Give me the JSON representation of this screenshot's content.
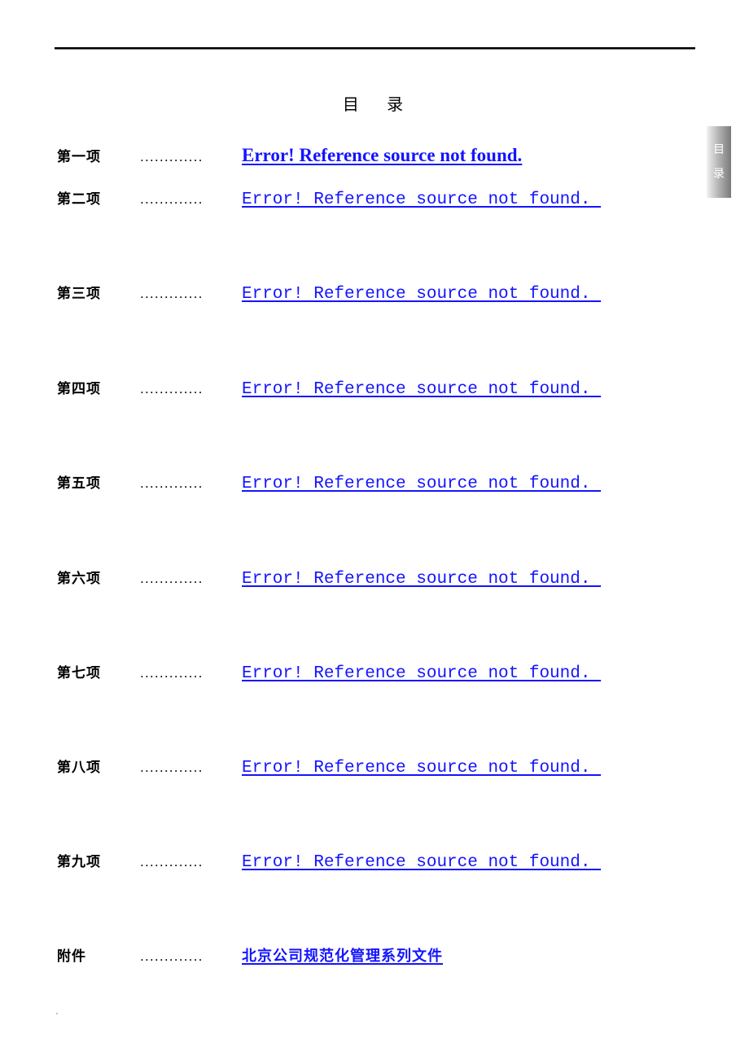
{
  "document": {
    "title": "目 录",
    "side_tab": [
      "目",
      "录"
    ],
    "toc": [
      {
        "label": "第一项",
        "dots": ".............",
        "link": "Error! Reference source not found.",
        "style": "bold"
      },
      {
        "label": "第二项",
        "dots": ".............",
        "link": "Error! Reference source not found. ",
        "style": "mono"
      },
      {
        "label": "第三项",
        "dots": ".............",
        "link": "Error! Reference source not found. ",
        "style": "mono"
      },
      {
        "label": "第四项",
        "dots": ".............",
        "link": "Error! Reference source not found. ",
        "style": "mono"
      },
      {
        "label": "第五项",
        "dots": ".............",
        "link": "Error! Reference source not found. ",
        "style": "mono"
      },
      {
        "label": "第六项",
        "dots": ".............",
        "link": "Error! Reference source not found. ",
        "style": "mono"
      },
      {
        "label": "第七项",
        "dots": ".............",
        "link": "Error! Reference source not found. ",
        "style": "mono"
      },
      {
        "label": "第八项",
        "dots": ".............",
        "link": "Error! Reference source not found. ",
        "style": "mono"
      },
      {
        "label": "第九项",
        "dots": ".............",
        "link": "Error! Reference source not found. ",
        "style": "mono"
      },
      {
        "label": "附件",
        "dots": ".............",
        "link": "北京公司规范化管理系列文件",
        "style": "cjk"
      }
    ],
    "link_color": "#1414ff"
  }
}
